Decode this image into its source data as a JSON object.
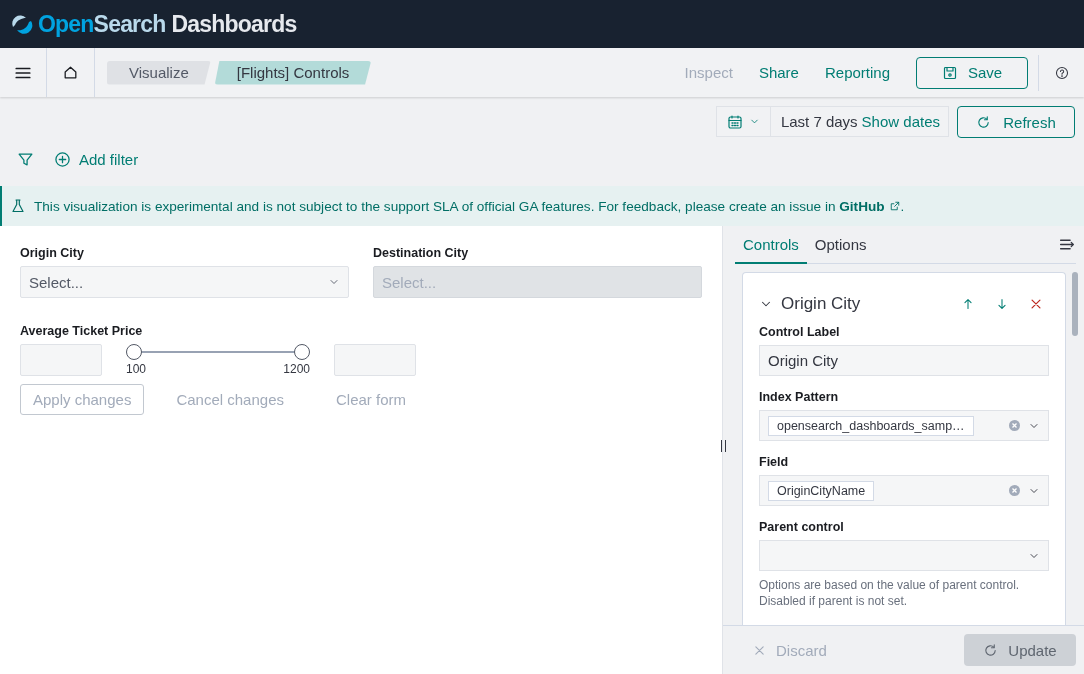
{
  "header": {
    "brand_parts": [
      "Open",
      "Search",
      "Dashboards"
    ]
  },
  "nav": {
    "breadcrumbs": [
      {
        "label": "Visualize",
        "selected": false
      },
      {
        "label": "[Flights] Controls",
        "selected": true
      }
    ],
    "actions": [
      {
        "label": "Inspect",
        "disabled": true
      },
      {
        "label": "Share",
        "disabled": false
      },
      {
        "label": "Reporting",
        "disabled": false
      }
    ],
    "save_button": "Save"
  },
  "query_bar": {
    "date_range": "Last 7 days",
    "show_dates": "Show dates",
    "refresh_button": "Refresh",
    "add_filter": "Add filter"
  },
  "callout": {
    "text": "This visualization is experimental and is not subject to the support SLA of official GA features. For feedback, please create an issue in ",
    "link": "GitHub",
    "end": "."
  },
  "controls": [
    {
      "kind": "select",
      "label": "Origin City",
      "placeholder": "Select...",
      "disabled": false
    },
    {
      "kind": "select",
      "label": "Destination City",
      "placeholder": "Select...",
      "disabled": true
    }
  ],
  "range": {
    "label": "Average Ticket Price",
    "min": "100",
    "max": "1200",
    "thumbs": [
      {
        "level": 0
      },
      {
        "level": 1
      }
    ]
  },
  "buttons": [
    {
      "kind": "outline",
      "label": "Apply changes",
      "disabled": true
    },
    {
      "kind": "text",
      "label": "Cancel changes",
      "disabled": true
    },
    {
      "kind": "text",
      "label": "Clear form",
      "disabled": true
    }
  ],
  "editor": {
    "tabs": [
      {
        "label": "Controls",
        "selected": true
      },
      {
        "label": "Options",
        "selected": false
      }
    ],
    "control": {
      "title": "Origin City",
      "expanded": true,
      "fields": [
        {
          "kind": "text",
          "label": "Control Label",
          "value": "Origin City"
        },
        {
          "kind": "combo",
          "label": "Index Pattern",
          "value": "opensearch_dashboards_samp…"
        },
        {
          "kind": "combo",
          "label": "Field",
          "value": "OriginCityName"
        },
        {
          "kind": "select",
          "label": "Parent control",
          "help": "Options are based on the value of parent control. Disabled if parent is not set."
        }
      ]
    },
    "discard_button": "Discard",
    "update_button": {
      "label": "Update",
      "disabled": true
    }
  }
}
